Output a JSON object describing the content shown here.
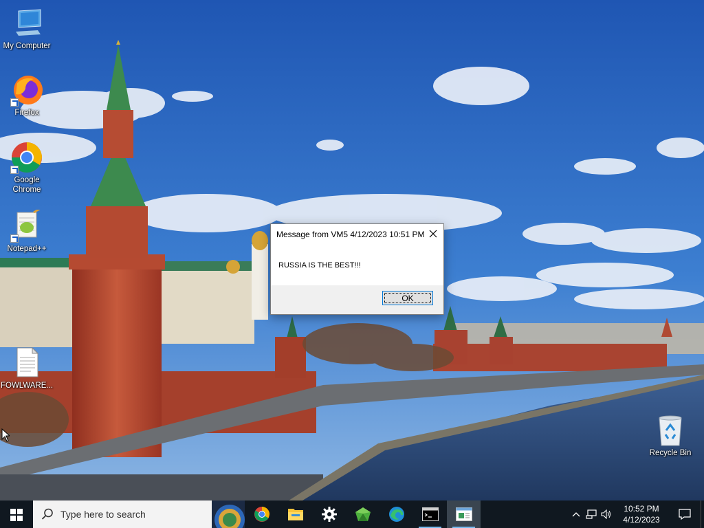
{
  "desktop": {
    "icons": [
      {
        "label": "My Computer",
        "icon": "computer-icon"
      },
      {
        "label": "Firefox",
        "icon": "firefox-icon"
      },
      {
        "label": "Google Chrome",
        "icon": "chrome-icon"
      },
      {
        "label": "Notepad++",
        "icon": "notepadpp-icon"
      },
      {
        "label": "FOWLWARE...",
        "icon": "document-icon"
      },
      {
        "label": "Recycle Bin",
        "icon": "recycle-bin-icon"
      }
    ]
  },
  "dialog": {
    "title": "Message from VM5 4/12/2023 10:51 PM",
    "message": "RUSSIA IS THE BEST!!!",
    "ok_label": "OK"
  },
  "taskbar": {
    "search_placeholder": "Type here to search",
    "apps": [
      {
        "name": "Google Chrome",
        "icon": "chrome-icon"
      },
      {
        "name": "File Explorer",
        "icon": "folder-icon"
      },
      {
        "name": "Settings",
        "icon": "gear-icon"
      },
      {
        "name": "App",
        "icon": "green-gem-icon"
      },
      {
        "name": "Microsoft Edge",
        "icon": "edge-icon"
      },
      {
        "name": "Command Prompt",
        "icon": "cmd-icon"
      },
      {
        "name": "Message",
        "icon": "message-window-icon"
      }
    ],
    "clock": {
      "time": "10:52 PM",
      "date": "4/12/2023"
    }
  },
  "colors": {
    "taskbar": "#101820",
    "accent": "#0078d7",
    "sky": "#2a63b8",
    "kremlin_red": "#b5442f"
  }
}
